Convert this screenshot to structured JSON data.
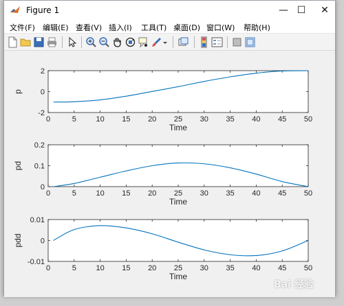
{
  "window": {
    "title": "Figure 1",
    "minimize_glyph": "—",
    "maximize_glyph": "☐",
    "close_glyph": "✕"
  },
  "menu": [
    "文件(F)",
    "编辑(E)",
    "查看(V)",
    "插入(I)",
    "工具(T)",
    "桌面(D)",
    "窗口(W)",
    "帮助(H)"
  ],
  "toolbar_icons": [
    "new-figure-icon",
    "open-file-icon",
    "save-icon",
    "print-icon",
    "edit-plot-arrow-icon",
    "zoom-in-icon",
    "zoom-out-icon",
    "pan-hand-icon",
    "rotate-3d-icon",
    "data-cursor-icon",
    "brush-icon",
    "link-plot-icon",
    "colorbar-icon",
    "legend-icon",
    "hide-plot-tools-icon",
    "show-plot-tools-icon"
  ],
  "accent_color": "#0072bd",
  "watermark": "Bai 经验",
  "chart_data": [
    {
      "type": "line",
      "ylabel": "p",
      "xlabel": "Time",
      "xlim": [
        0,
        50
      ],
      "ylim": [
        -2,
        2
      ],
      "xticks": [
        "0",
        "5",
        "10",
        "15",
        "20",
        "25",
        "30",
        "35",
        "40",
        "45",
        "50"
      ],
      "yticks": [
        "-2",
        "0",
        "2"
      ],
      "x": [
        1,
        5,
        10,
        15,
        20,
        25,
        30,
        35,
        40,
        45,
        50
      ],
      "series": [
        {
          "values": [
            -1.0,
            -0.97,
            -0.79,
            -0.44,
            0.01,
            0.47,
            0.97,
            1.41,
            1.76,
            1.97,
            2.0
          ]
        }
      ],
      "grid": false
    },
    {
      "type": "line",
      "ylabel": "pd",
      "xlabel": "Time",
      "xlim": [
        0,
        50
      ],
      "ylim": [
        0,
        0.2
      ],
      "xticks": [
        "0",
        "5",
        "10",
        "15",
        "20",
        "25",
        "30",
        "35",
        "40",
        "45",
        "50"
      ],
      "yticks": [
        "0",
        "0.1",
        "0.2"
      ],
      "x": [
        1,
        5,
        10,
        15,
        20,
        25,
        30,
        35,
        40,
        45,
        50
      ],
      "series": [
        {
          "values": [
            0.0,
            0.015,
            0.045,
            0.075,
            0.1,
            0.113,
            0.109,
            0.09,
            0.06,
            0.024,
            0.0
          ]
        }
      ],
      "grid": false
    },
    {
      "type": "line",
      "ylabel": "pdd",
      "xlabel": "Time",
      "xlim": [
        0,
        50
      ],
      "ylim": [
        -0.01,
        0.01
      ],
      "xticks": [
        "0",
        "5",
        "10",
        "15",
        "20",
        "25",
        "30",
        "35",
        "40",
        "45",
        "50"
      ],
      "yticks": [
        "-0.01",
        "0",
        "0.01"
      ],
      "x": [
        1,
        5,
        10,
        15,
        20,
        25,
        30,
        35,
        40,
        45,
        50
      ],
      "series": [
        {
          "values": [
            0.0,
            0.0052,
            0.0071,
            0.006,
            0.0032,
            -0.0008,
            -0.0045,
            -0.0068,
            -0.0072,
            -0.005,
            0.0
          ]
        }
      ],
      "grid": false
    }
  ]
}
